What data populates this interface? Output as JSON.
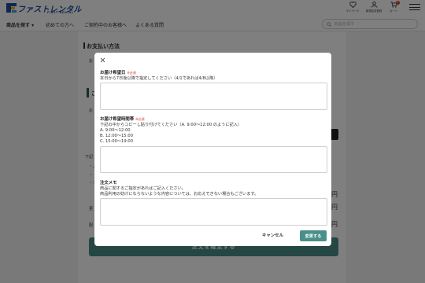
{
  "header": {
    "logo_jp": "ファストレンタル",
    "logo_en": "FIRST RENTAL",
    "mypage_label": "マイページ",
    "newmember_label": "新規会員登録",
    "cart_label": "カート",
    "cart_count": "0"
  },
  "nav": {
    "items": [
      "商品を探す ▾",
      "初めての方へ",
      "ご契約中のお客様へ",
      "よくある質問"
    ],
    "search_placeholder": "商品を探す"
  },
  "background": {
    "section_title": "お支払い方法",
    "fragments": [
      "お",
      "ご",
      "お",
      "下記",
      "・入",
      "・",
      "・ア",
      "更",
      "配"
    ],
    "prices": [
      "円",
      "円",
      "円"
    ],
    "submit_label": "注文を確定する"
  },
  "modal": {
    "delivery_date": {
      "label": "お届け希望日",
      "required": "※必須",
      "help": "本日から7日後以降で指定してください（4/1であれば4/8以降）",
      "value": ""
    },
    "delivery_time": {
      "label": "お届け希望時間帯",
      "required": "※必須",
      "help_lines": [
        "下記の中からコピーし貼り付けてください（A. 9:00〜12:00 のように記入）",
        "A. 9:00〜12:00",
        "B. 12:00〜15:00",
        "C. 15:00〜19:00"
      ],
      "value": ""
    },
    "memo": {
      "label": "注文メモ",
      "help_lines": [
        "商品に関するご指定があればご記入ください。",
        "商品利用の妨げにならないような内容については、お応えできない場合もございます。"
      ],
      "value": ""
    },
    "cancel_label": "キャンセル",
    "confirm_label": "変更する"
  },
  "colors": {
    "brand_blue": "#1f4d9e",
    "accent_teal": "#4a8f89",
    "required_red": "#d9342b"
  }
}
